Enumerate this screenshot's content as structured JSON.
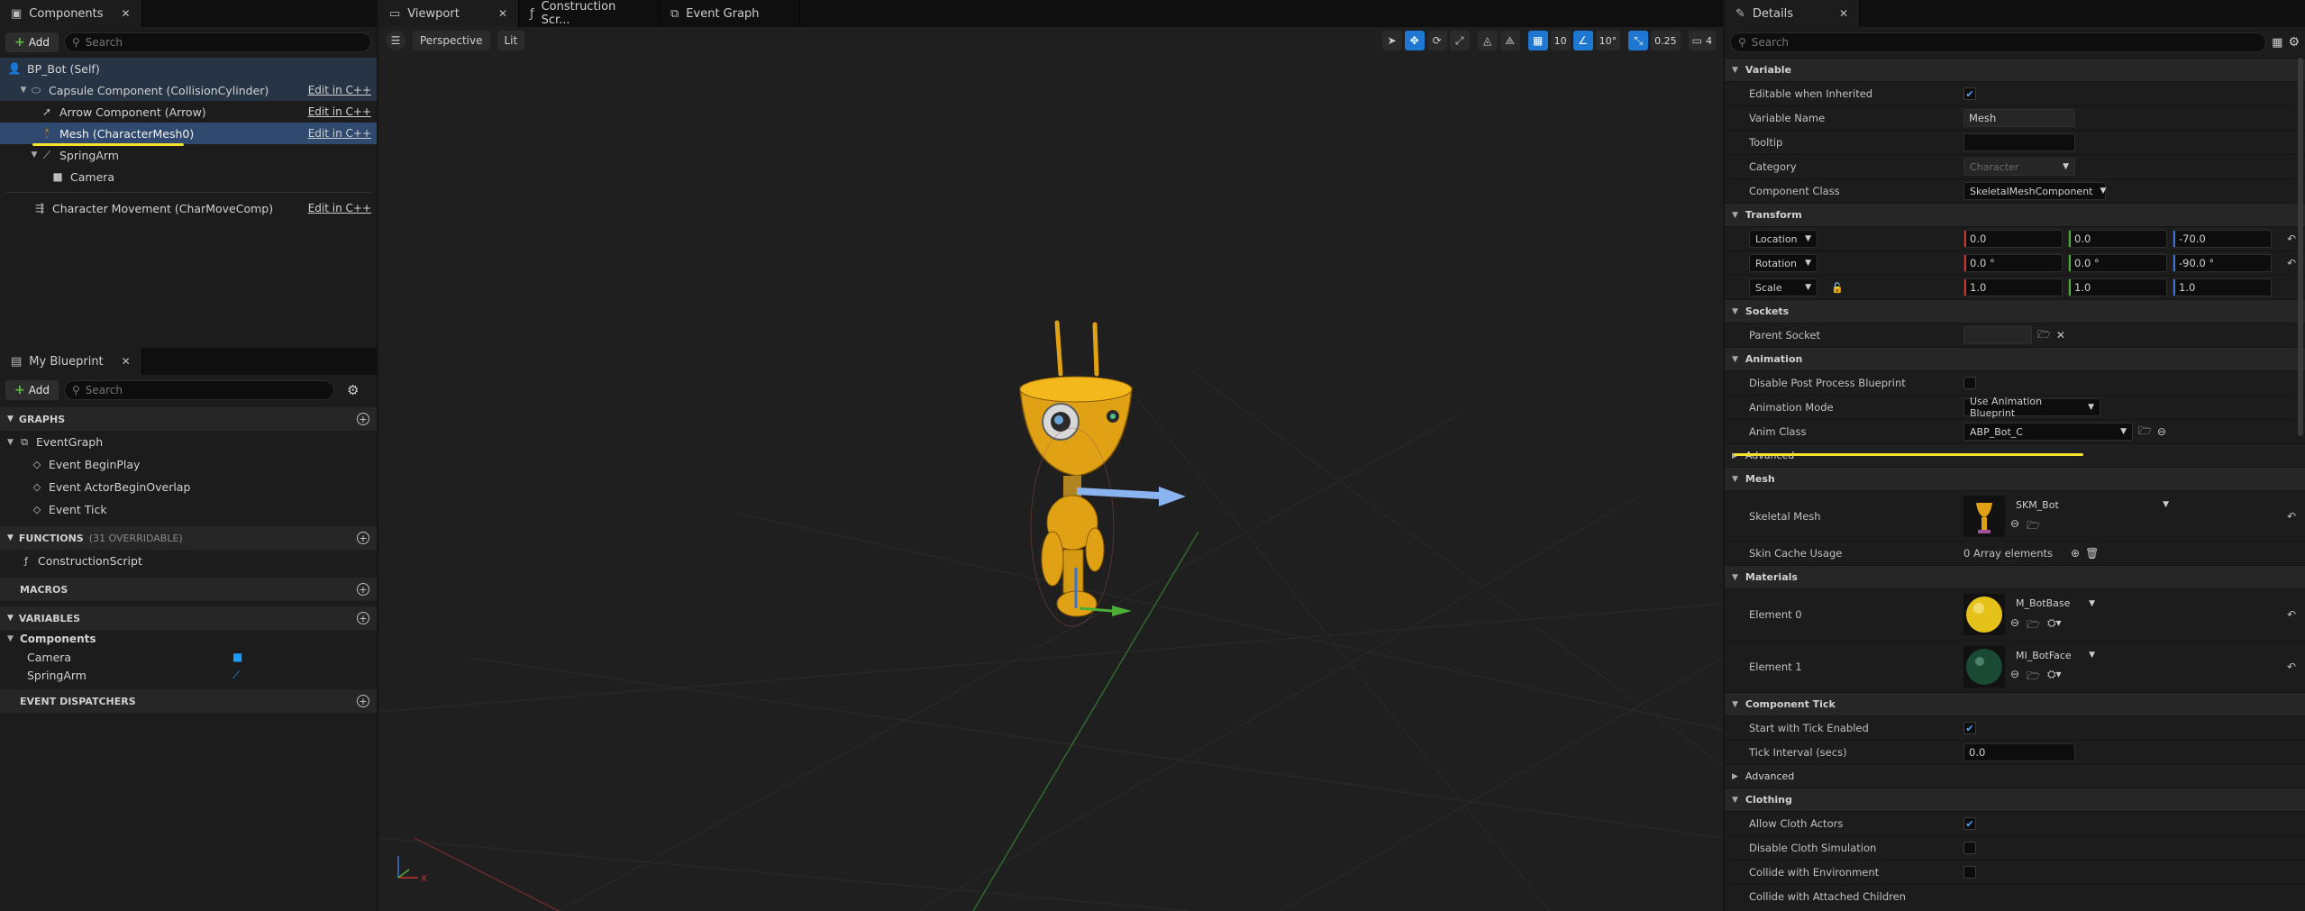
{
  "components_panel": {
    "tab_label": "Components",
    "add_label": "Add",
    "search_placeholder": "Search",
    "tree": [
      {
        "label": "BP_Bot (Self)",
        "edit": ""
      },
      {
        "label": "Capsule Component (CollisionCylinder)",
        "edit": "Edit in C++"
      },
      {
        "label": "Arrow Component (Arrow)",
        "edit": "Edit in C++"
      },
      {
        "label": "Mesh (CharacterMesh0)",
        "edit": "Edit in C++"
      },
      {
        "label": "SpringArm",
        "edit": ""
      },
      {
        "label": "Camera",
        "edit": ""
      },
      {
        "label": "Character Movement (CharMoveComp)",
        "edit": "Edit in C++"
      }
    ]
  },
  "myblueprint_panel": {
    "tab_label": "My Blueprint",
    "add_label": "Add",
    "search_placeholder": "Search",
    "graphs_header": "GRAPHS",
    "graphs": [
      {
        "label": "EventGraph"
      },
      {
        "label": "Event BeginPlay"
      },
      {
        "label": "Event ActorBeginOverlap"
      },
      {
        "label": "Event Tick"
      }
    ],
    "functions_header": "FUNCTIONS",
    "functions_overridable": "(31 OVERRIDABLE)",
    "functions": [
      {
        "label": "ConstructionScript"
      }
    ],
    "macros_header": "MACROS",
    "variables_header": "VARIABLES",
    "variables_group": "Components",
    "variables": [
      {
        "label": "Camera"
      },
      {
        "label": "SpringArm"
      }
    ],
    "dispatchers_header": "EVENT DISPATCHERS"
  },
  "editor_tabs": [
    {
      "label": "Viewport"
    },
    {
      "label": "Construction Scr..."
    },
    {
      "label": "Event Graph"
    }
  ],
  "viewport": {
    "perspective_label": "Perspective",
    "lit_label": "Lit",
    "grid_snap": "10",
    "rotation_snap": "10°",
    "scale_snap": "0.25",
    "camera_speed": "4",
    "axis_x": "X"
  },
  "details": {
    "tab_label": "Details",
    "search_placeholder": "Search",
    "sections": {
      "variable": "Variable",
      "transform": "Transform",
      "sockets": "Sockets",
      "animation": "Animation",
      "advanced": "Advanced",
      "mesh": "Mesh",
      "materials": "Materials",
      "component_tick": "Component Tick",
      "advanced2": "Advanced",
      "clothing": "Clothing"
    },
    "labels": {
      "editable_when_inherited": "Editable when Inherited",
      "variable_name": "Variable Name",
      "tooltip": "Tooltip",
      "category": "Category",
      "component_class": "Component Class",
      "location": "Location",
      "rotation": "Rotation",
      "scale": "Scale",
      "parent_socket": "Parent Socket",
      "disable_post_process": "Disable Post Process Blueprint",
      "animation_mode": "Animation Mode",
      "anim_class": "Anim Class",
      "skeletal_mesh": "Skeletal Mesh",
      "skin_cache_usage": "Skin Cache Usage",
      "element0": "Element 0",
      "element1": "Element 1",
      "start_with_tick": "Start with Tick Enabled",
      "tick_interval": "Tick Interval (secs)",
      "allow_cloth_actors": "Allow Cloth Actors",
      "disable_cloth_sim": "Disable Cloth Simulation",
      "collide_with_env": "Collide with Environment",
      "collide_with_attached": "Collide with Attached Children"
    },
    "values": {
      "variable_name": "Mesh",
      "tooltip": "",
      "category": "Character",
      "component_class": "SkeletalMeshComponent",
      "location": [
        "0.0",
        "0.0",
        "-70.0"
      ],
      "rotation": [
        "0.0 °",
        "0.0 °",
        "-90.0 °"
      ],
      "scale": [
        "1.0",
        "1.0",
        "1.0"
      ],
      "animation_mode": "Use Animation Blueprint",
      "anim_class": "ABP_Bot_C",
      "skeletal_mesh": "SKM_Bot",
      "skin_cache_usage": "0 Array elements",
      "material0": "M_BotBase",
      "material1": "MI_BotFace",
      "tick_interval": "0.0"
    }
  }
}
